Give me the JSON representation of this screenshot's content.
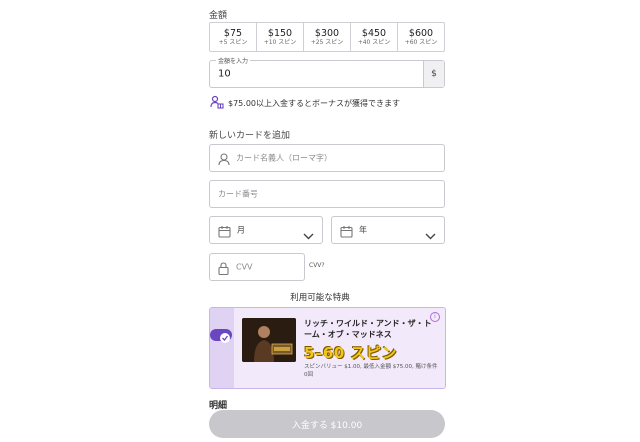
{
  "amount_section_label": "金額",
  "amount_presets": [
    {
      "value": "$75",
      "spins": "+5 スピン"
    },
    {
      "value": "$150",
      "spins": "+10 スピン"
    },
    {
      "value": "$300",
      "spins": "+25 スピン"
    },
    {
      "value": "$450",
      "spins": "+40 スピン"
    },
    {
      "value": "$600",
      "spins": "+60 スピン"
    }
  ],
  "amount_input": {
    "label": "金額を入力",
    "value": "10",
    "currency": "$"
  },
  "bonus_note": "$75.00以上入金するとボーナスが獲得できます",
  "new_card_label": "新しいカードを追加",
  "card_holder_placeholder": "カード名義人（ローマ字）",
  "card_number_placeholder": "カード番号",
  "month_placeholder": "月",
  "year_placeholder": "年",
  "cvv_placeholder": "CVV",
  "cvv_hint": "CVV?",
  "offers_label": "利用可能な特典",
  "offer": {
    "title": "リッチ・ワイルド・アンド・ザ・トーム・オブ・マッドネス",
    "spins": "5–60 スピン",
    "meta": "スピンバリュー $1.00, 最低入金額 $75.00, 賭け条件 0回",
    "info_icon": "i"
  },
  "details_label": "明細",
  "cta_label": "入金する $10.00",
  "colors": {
    "accent": "#6b46c1",
    "cta_bg": "#c7c7cc"
  }
}
